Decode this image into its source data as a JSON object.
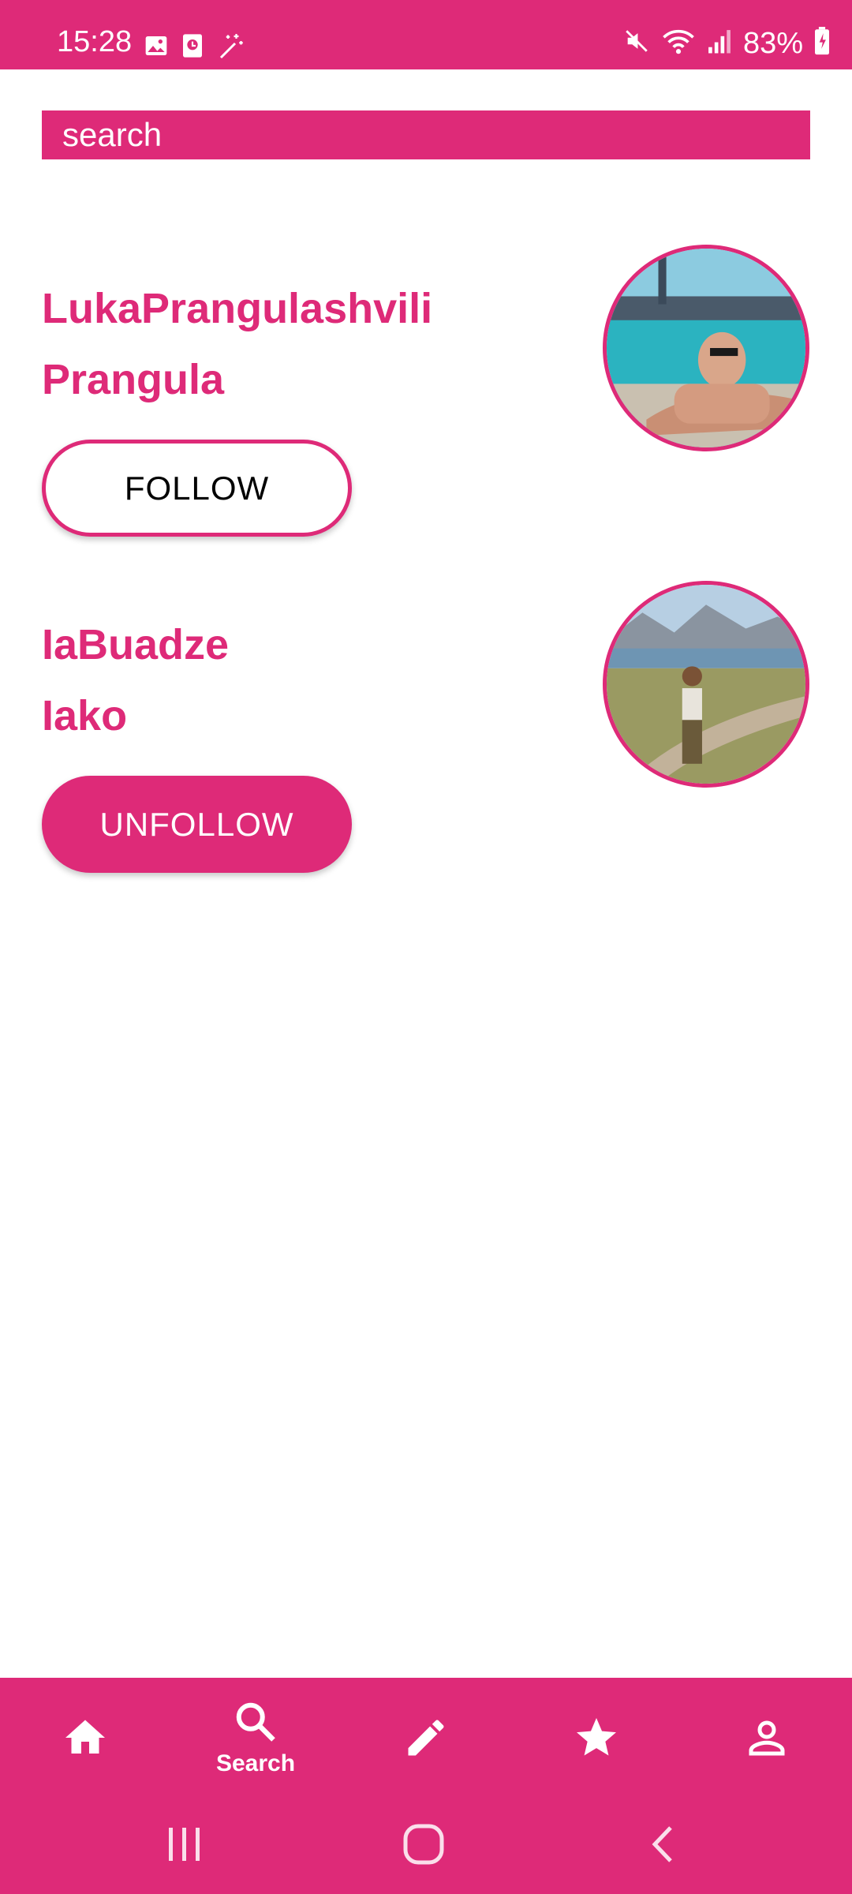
{
  "status_bar": {
    "time": "15:28",
    "battery": "83%",
    "left_icons": [
      "gallery-icon",
      "media-icon",
      "magic-wand-icon"
    ],
    "right_icons": [
      "mute-icon",
      "wifi-icon",
      "signal-icon",
      "battery-icon"
    ]
  },
  "search": {
    "placeholder": "search"
  },
  "users": [
    {
      "username": "LukaPrangulashvili",
      "nickname": "Prangula",
      "button_label": "FOLLOW",
      "following": false
    },
    {
      "username": "IaBuadze",
      "nickname": "Iako",
      "button_label": "UNFOLLOW",
      "following": true
    }
  ],
  "bottom_nav": {
    "items": [
      {
        "icon": "home-icon",
        "label": ""
      },
      {
        "icon": "search-icon",
        "label": "Search",
        "selected": true
      },
      {
        "icon": "edit-icon",
        "label": ""
      },
      {
        "icon": "star-icon",
        "label": ""
      },
      {
        "icon": "profile-icon",
        "label": ""
      }
    ]
  },
  "colors": {
    "accent": "#DE2A78",
    "background": "#FFFFFF",
    "button_outline_text": "#000000"
  }
}
